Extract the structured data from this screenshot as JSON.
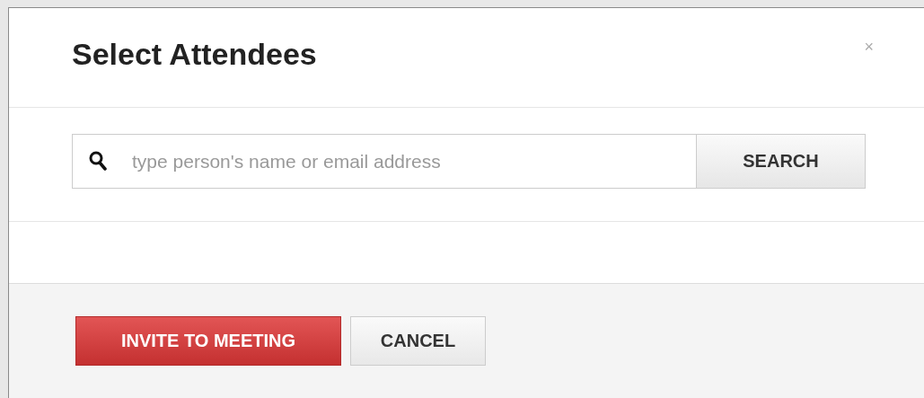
{
  "dialog": {
    "title": "Select Attendees",
    "close": "×"
  },
  "search": {
    "placeholder": "type person's name or email address",
    "button": "SEARCH"
  },
  "buttons": [
    {
      "label": "INVITE TO MEETING",
      "kind": "primary"
    },
    {
      "label": "CANCEL",
      "kind": "secondary"
    }
  ]
}
